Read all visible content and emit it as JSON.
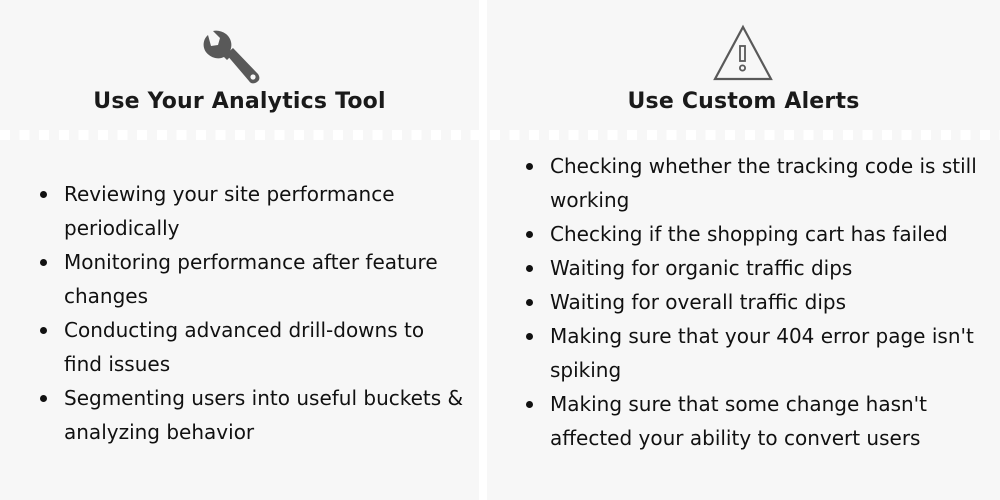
{
  "colors": {
    "background": "#f7f7f7",
    "divider": "#ffffff",
    "icon": "#595959",
    "text": "#111111"
  },
  "left": {
    "icon": "wrench-icon",
    "heading": "Use Your Analytics Tool",
    "items": [
      "Reviewing your site performance periodically",
      "Monitoring performance after feature changes",
      "Conducting advanced drill-downs to find issues",
      "Segmenting users into useful buckets & analyzing behavior"
    ]
  },
  "right": {
    "icon": "warning-triangle-icon",
    "heading": "Use Custom Alerts",
    "items": [
      "Checking whether the tracking code is still working",
      "Checking if the shopping cart has failed",
      "Waiting for organic traffic dips",
      "Waiting for overall traffic dips",
      "Making sure that your 404 error page isn't spiking",
      "Making sure that some change hasn't affected your ability to convert users"
    ]
  }
}
